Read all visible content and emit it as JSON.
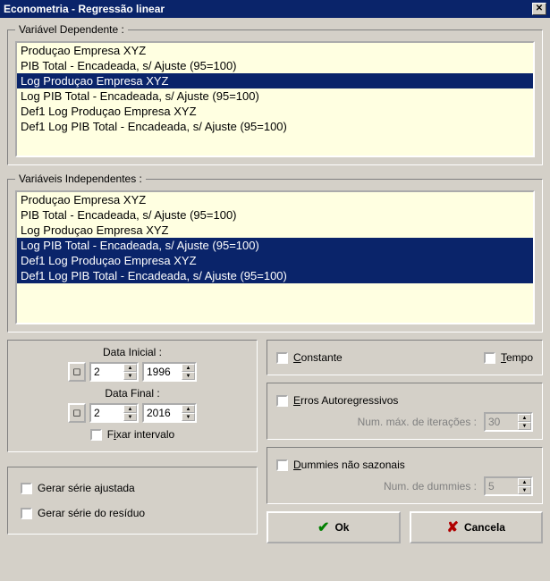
{
  "window": {
    "title": "Econometria - Regressão linear",
    "close_glyph": "✕"
  },
  "dependent": {
    "legend": "Variável Dependente :",
    "items": [
      {
        "label": "Produçao Empresa XYZ",
        "selected": false
      },
      {
        "label": "PIB Total - Encadeada, s/ Ajuste (95=100)",
        "selected": false
      },
      {
        "label": "Log Produçao Empresa XYZ",
        "selected": true
      },
      {
        "label": "Log PIB Total - Encadeada, s/ Ajuste (95=100)",
        "selected": false
      },
      {
        "label": "Def1 Log Produçao Empresa XYZ",
        "selected": false
      },
      {
        "label": "Def1 Log PIB Total - Encadeada, s/ Ajuste (95=100)",
        "selected": false
      }
    ]
  },
  "independent": {
    "legend": "Variáveis Independentes :",
    "items": [
      {
        "label": "Produçao Empresa XYZ",
        "selected": false
      },
      {
        "label": "PIB Total - Encadeada, s/ Ajuste (95=100)",
        "selected": false
      },
      {
        "label": "Log Produçao Empresa XYZ",
        "selected": false
      },
      {
        "label": "Log PIB Total - Encadeada, s/ Ajuste (95=100)",
        "selected": true
      },
      {
        "label": "Def1 Log Produçao Empresa XYZ",
        "selected": true
      },
      {
        "label": "Def1 Log PIB Total - Encadeada, s/ Ajuste (95=100)",
        "selected": true
      }
    ]
  },
  "dates": {
    "start_label": "Data Inicial :",
    "start_month": "2",
    "start_year": "1996",
    "end_label": "Data Final :",
    "end_month": "2",
    "end_year": "2016",
    "fix_interval_label": {
      "pre": "F",
      "ul": "i",
      "post": "xar intervalo"
    }
  },
  "series": {
    "adjusted_label": "Gerar série ajustada",
    "residual_label": "Gerar série do resíduo"
  },
  "options": {
    "constant_label": {
      "ul": "C",
      "post": "onstante"
    },
    "tempo_label": {
      "ul": "T",
      "post": "empo"
    },
    "ar_errors_label": {
      "ul": "E",
      "post": "rros Autoregressivos"
    },
    "max_iter_label": {
      "pre": "Num. ",
      "ul": "m",
      "post": "áx. de iterações :"
    },
    "max_iter_value": "30",
    "dummies_label": {
      "ul": "D",
      "post": "ummies não sazonais"
    },
    "num_dummies_label": "Num. de dummies :",
    "num_dummies_value": "5"
  },
  "buttons": {
    "ok_label": {
      "ul": "O",
      "post": "k"
    },
    "cancel_label": "Cancela",
    "ok_glyph": "✔",
    "cancel_glyph": "✘"
  }
}
